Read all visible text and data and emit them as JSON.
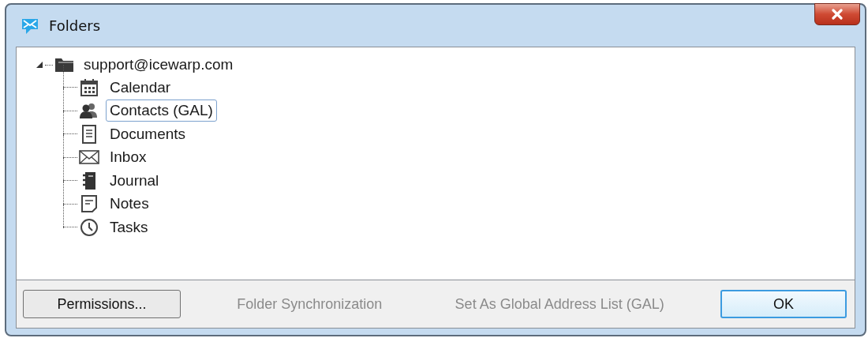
{
  "window": {
    "title": "Folders"
  },
  "tree": {
    "label": "support@icewarp.com",
    "expanded": true,
    "selected": false,
    "children": [
      {
        "label": "Calendar",
        "kind": "calendar",
        "selected": false
      },
      {
        "label": "Contacts (GAL)",
        "kind": "contacts",
        "selected": true
      },
      {
        "label": "Documents",
        "kind": "documents",
        "selected": false
      },
      {
        "label": "Inbox",
        "kind": "inbox",
        "selected": false
      },
      {
        "label": "Journal",
        "kind": "journal",
        "selected": false
      },
      {
        "label": "Notes",
        "kind": "notes",
        "selected": false
      },
      {
        "label": "Tasks",
        "kind": "tasks",
        "selected": false
      }
    ]
  },
  "buttons": [
    {
      "label": "Permissions...",
      "disabled": false,
      "default": false
    },
    {
      "label": "Folder Synchronization",
      "disabled": true,
      "default": false
    },
    {
      "label": "Set As Global Address List (GAL)",
      "disabled": true,
      "default": false
    },
    {
      "label": "OK",
      "disabled": false,
      "default": true
    }
  ]
}
